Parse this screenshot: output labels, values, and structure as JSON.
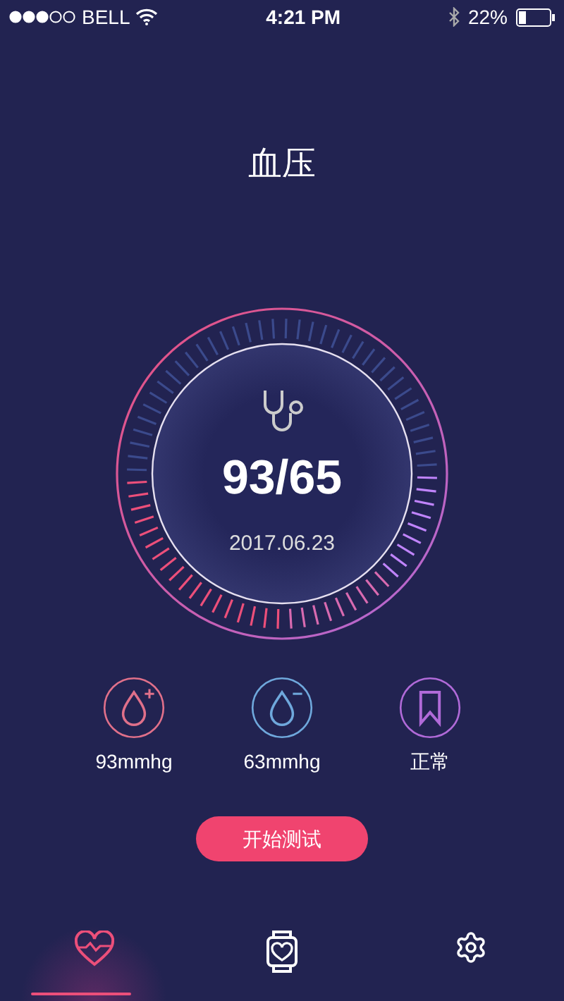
{
  "status_bar": {
    "carrier": "BELL",
    "time": "4:21 PM",
    "battery": "22%"
  },
  "title": "血压",
  "gauge": {
    "reading": "93/65",
    "date": "2017.06.23"
  },
  "stats": [
    {
      "kind": "high",
      "value": "93mmhg",
      "color": "#e0708a"
    },
    {
      "kind": "low",
      "value": "63mmhg",
      "color": "#6fa8dc"
    },
    {
      "kind": "status",
      "value": "正常",
      "color": "#b06ad8"
    }
  ],
  "start_button": "开始测试",
  "tabs": [
    {
      "kind": "heart",
      "selected": true
    },
    {
      "kind": "watch",
      "selected": false
    },
    {
      "kind": "settings",
      "selected": false
    }
  ]
}
